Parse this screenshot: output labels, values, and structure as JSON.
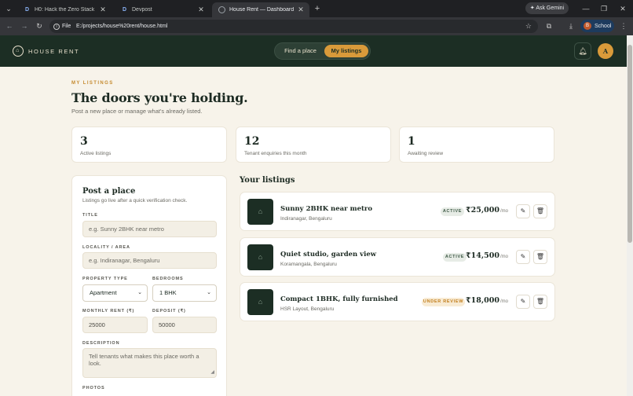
{
  "browser": {
    "tabs": [
      {
        "favicon": "D",
        "title": "H0: Hack the Zero Stack with V",
        "active": false
      },
      {
        "favicon": "D",
        "title": "Devpost",
        "active": false
      },
      {
        "favicon": "",
        "title": "House Rent — Dashboard",
        "active": true
      }
    ],
    "ask_gemini": "Ask Gemini",
    "address": {
      "scheme_label": "File",
      "url": "E:/projects/house%20rent/house.html"
    },
    "profile": {
      "initial": "B",
      "name": "School"
    }
  },
  "header": {
    "brand": "HOUSE RENT",
    "nav": {
      "find": "Find a place",
      "mine": "My listings"
    },
    "avatar": "A"
  },
  "page": {
    "eyebrow": "MY LISTINGS",
    "title": "The doors you're holding.",
    "subtitle": "Post a new place or manage what's already listed."
  },
  "stats": [
    {
      "value": "3",
      "label": "Active listings"
    },
    {
      "value": "12",
      "label": "Tenant enquiries this month"
    },
    {
      "value": "1",
      "label": "Awaiting review"
    }
  ],
  "form": {
    "title": "Post a place",
    "subtitle": "Listings go live after a quick verification check.",
    "title_label": "TITLE",
    "title_placeholder": "e.g. Sunny 2BHK near metro",
    "locality_label": "LOCALITY / AREA",
    "locality_placeholder": "e.g. Indiranagar, Bengaluru",
    "type_label": "PROPERTY TYPE",
    "type_value": "Apartment",
    "bedrooms_label": "BEDROOMS",
    "bedrooms_value": "1 BHK",
    "rent_label": "MONTHLY RENT (₹)",
    "rent_value": "25000",
    "deposit_label": "DEPOSIT (₹)",
    "deposit_value": "50000",
    "description_label": "DESCRIPTION",
    "description_placeholder": "Tell tenants what makes this place worth a look.",
    "photos_label": "PHOTOS"
  },
  "listings": {
    "title": "Your listings",
    "items": [
      {
        "name": "Sunny 2BHK near metro",
        "location": "Indiranagar, Bengaluru",
        "status": "ACTIVE",
        "status_kind": "active",
        "price": "₹25,000",
        "per": "/mo"
      },
      {
        "name": "Quiet studio, garden view",
        "location": "Koramangala, Bengaluru",
        "status": "ACTIVE",
        "status_kind": "active",
        "price": "₹14,500",
        "per": "/mo"
      },
      {
        "name": "Compact 1BHK, fully furnished",
        "location": "HSR Layout, Bengaluru",
        "status": "UNDER REVIEW",
        "status_kind": "review",
        "price": "₹18,000",
        "per": "/mo"
      }
    ]
  },
  "colors": {
    "header_bg": "#1c2e24",
    "accent": "#d99a3a",
    "page_bg": "#f7f3ea"
  }
}
